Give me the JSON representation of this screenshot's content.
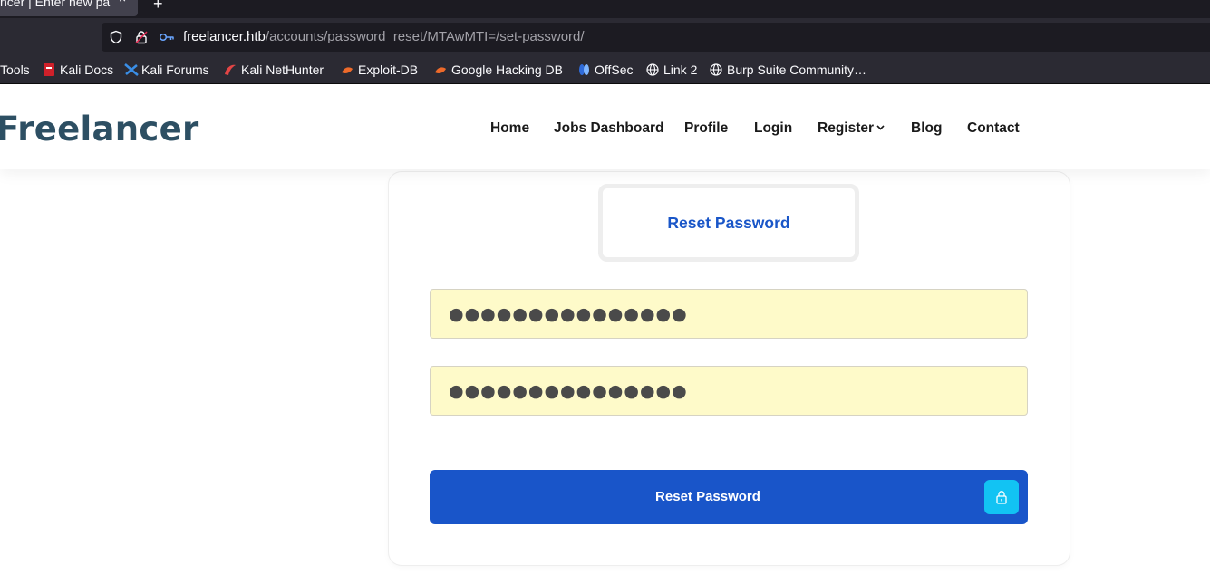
{
  "browser": {
    "tab_title": "ncer | Enter new pa",
    "tab_close": "×",
    "new_tab": "+",
    "url_host": "freelancer.htb",
    "url_path": "/accounts/password_reset/MTAwMTI=/set-password/",
    "icons": [
      "shield-icon",
      "lock-icon",
      "key-icon"
    ]
  },
  "bookmarks": [
    {
      "label": "Tools",
      "icon": ""
    },
    {
      "label": "Kali Docs",
      "icon": "kali-docs-icon"
    },
    {
      "label": "Kali Forums",
      "icon": "kali-forums-icon"
    },
    {
      "label": "Kali NetHunter",
      "icon": "kali-nethunter-icon"
    },
    {
      "label": "Exploit-DB",
      "icon": "exploit-db-icon"
    },
    {
      "label": "Google Hacking DB",
      "icon": "ghdb-icon"
    },
    {
      "label": "OffSec",
      "icon": "offsec-icon"
    },
    {
      "label": "Link 2",
      "icon": "globe-icon"
    },
    {
      "label": "Burp Suite Community…",
      "icon": "globe-icon"
    }
  ],
  "site": {
    "logo": "Freelancer",
    "nav": [
      "Home",
      "Jobs Dashboard",
      "Profile",
      "Login",
      "Register",
      "Blog",
      "Contact"
    ],
    "register_caret": "⌄"
  },
  "form": {
    "title": "Reset Password",
    "password1_masked": "●●●●●●●●●●●●●●●",
    "password2_masked": "●●●●●●●●●●●●●●●",
    "submit_label": "Reset Password",
    "submit_icon": "lock-icon"
  },
  "colors": {
    "accent": "#1955c9",
    "lock_bg": "#12c3f3",
    "field_bg": "#fefac9",
    "logo": "#2d4f63"
  }
}
